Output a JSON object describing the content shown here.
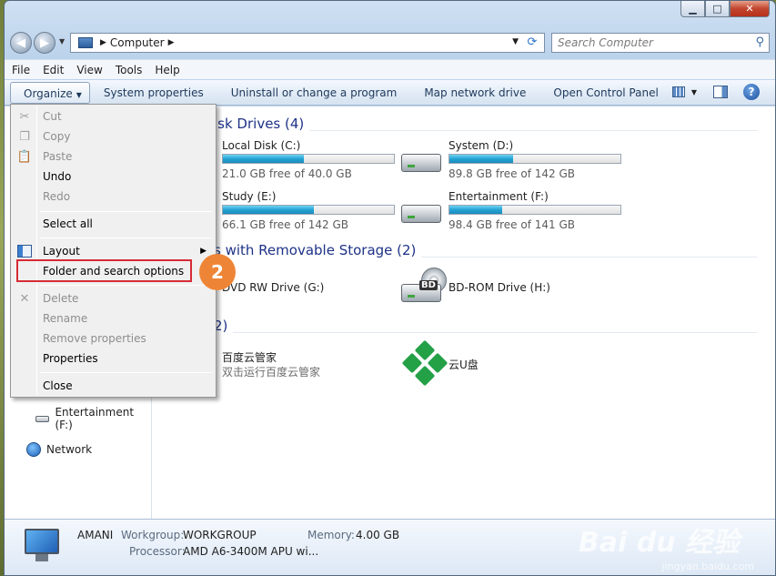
{
  "window": {
    "caption_buttons": {
      "minimize": "▁",
      "maximize": "□",
      "close": "✕"
    }
  },
  "nav": {
    "back": "◀",
    "forward": "▶",
    "address_segment": "Computer",
    "search_placeholder": "Search Computer"
  },
  "menubar": [
    "File",
    "Edit",
    "View",
    "Tools",
    "Help"
  ],
  "commandbar": {
    "organize": "Organize",
    "system_properties": "System properties",
    "uninstall": "Uninstall or change a program",
    "map_drive": "Map network drive",
    "control_panel": "Open Control Panel"
  },
  "sections": {
    "hdd_title": "isk Drives (4)",
    "removable_title": "s with Removable Storage (2)",
    "other_title": "2)"
  },
  "drives": [
    {
      "name": "Local Disk (C:)",
      "free": "21.0 GB free of 40.0 GB",
      "used_fraction": 0.475
    },
    {
      "name": "System (D:)",
      "free": "89.8 GB free of 142 GB",
      "used_fraction": 0.37
    },
    {
      "name": "Study (E:)",
      "free": "66.1 GB free of 142 GB",
      "used_fraction": 0.53
    },
    {
      "name": "Entertainment (F:)",
      "free": "98.4 GB free of 141 GB",
      "used_fraction": 0.31
    }
  ],
  "removable": [
    {
      "name": "DVD RW Drive (G:)"
    },
    {
      "name": "BD-ROM Drive (H:)",
      "badge": "BD"
    }
  ],
  "other": [
    {
      "name": "百度云管家",
      "sub": "双击运行百度云管家"
    },
    {
      "name": "云U盘"
    }
  ],
  "navpane": {
    "entertainment": "Entertainment (F:)",
    "network": "Network"
  },
  "context_menu": {
    "cut": "Cut",
    "copy": "Copy",
    "paste": "Paste",
    "undo": "Undo",
    "redo": "Redo",
    "select_all": "Select all",
    "layout": "Layout",
    "folder_options": "Folder and search options",
    "delete": "Delete",
    "rename": "Rename",
    "remove_properties": "Remove properties",
    "properties": "Properties",
    "close": "Close"
  },
  "step_badge": "2",
  "details": {
    "computer_name": "AMANI",
    "workgroup_label": "Workgroup:",
    "workgroup": "WORKGROUP",
    "memory_label": "Memory:",
    "memory": "4.00 GB",
    "processor_label": "Processor:",
    "processor": "AMD A6-3400M APU wi..."
  },
  "watermark": {
    "brand": "Bai du 经验",
    "url": "jingyan.baidu.com"
  },
  "colors": {
    "accent": "#1e3287",
    "highlight_box": "#d62b35",
    "badge": "#ee8536",
    "drive_bar": "#25a3d3"
  }
}
